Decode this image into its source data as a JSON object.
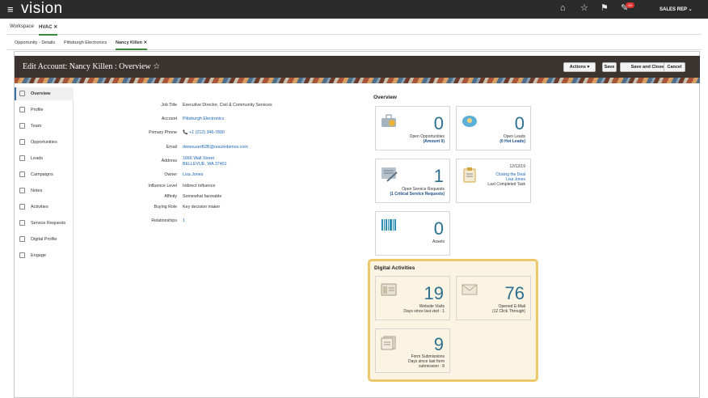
{
  "app": {
    "logo": "vision",
    "user": "SALES REP",
    "notif_count": "99"
  },
  "tabs_top": [
    {
      "label": "Workspace"
    },
    {
      "label": "HVAC"
    }
  ],
  "tabs_sub": [
    {
      "label": "Opportunity - Details"
    },
    {
      "label": "Pittsburgh Electronics"
    },
    {
      "label": "Nancy Killen"
    }
  ],
  "header": {
    "title": "Edit Account: Nancy Killen : Overview",
    "actions": "Actions",
    "save": "Save",
    "save_close": "Save and Close",
    "cancel": "Cancel"
  },
  "sidebar": [
    {
      "label": "Overview"
    },
    {
      "label": "Profile"
    },
    {
      "label": "Team"
    },
    {
      "label": "Opportunities"
    },
    {
      "label": "Leads"
    },
    {
      "label": "Campaigns"
    },
    {
      "label": "Notes"
    },
    {
      "label": "Activities"
    },
    {
      "label": "Service Requests"
    },
    {
      "label": "Digital Profile"
    },
    {
      "label": "Engage"
    }
  ],
  "fields": {
    "job_title": {
      "label": "Job Title",
      "value": "Executive Director, Civil & Community Services"
    },
    "account": {
      "label": "Account",
      "value": "Pittsburgh Electronics"
    },
    "phone": {
      "label": "Primary Phone",
      "value": "+1 (212) 346-7890"
    },
    "email": {
      "label": "Email",
      "value": "demouserB2B@oracledemos.com"
    },
    "address": {
      "label": "Address",
      "line1": "1666 Wall Street",
      "line2": "BELLEVUE, WA 37401"
    },
    "owner": {
      "label": "Owner",
      "value": "Lisa Jones"
    },
    "influence": {
      "label": "Influence Level",
      "value": "Indirect Influence"
    },
    "affinity": {
      "label": "Affinity",
      "value": "Somewhat favorable"
    },
    "buying_role": {
      "label": "Buying Role",
      "value": "Key decision maker"
    },
    "relationships": {
      "label": "Relationships",
      "value": "1"
    }
  },
  "overview": {
    "title": "Overview",
    "opportunities": {
      "count": "0",
      "label": "Open Opportunities",
      "sub": "(Amount 0)"
    },
    "leads": {
      "count": "0",
      "label": "Open Leads",
      "sub": "(0 Hot Leads)"
    },
    "service": {
      "count": "1",
      "label": "Open Service Requests",
      "sub": "(1 Critical Service Requests)"
    },
    "task": {
      "date": "12/12/19",
      "title": "Closing the Deal",
      "owner": "Lisa Jones",
      "label": "Last Completed Task"
    },
    "assets": {
      "count": "0",
      "label": "Assets"
    }
  },
  "digital": {
    "title": "Digital Activities",
    "visits": {
      "count": "19",
      "label": "Website Visits",
      "sub": "Days since last visit : 1"
    },
    "email": {
      "count": "76",
      "label": "Opened E-Mail",
      "sub": "(12 Click Through)"
    },
    "forms": {
      "count": "9",
      "label": "Form Submissions",
      "sub": "Days since last form",
      "sub2": "submission : 8"
    }
  }
}
